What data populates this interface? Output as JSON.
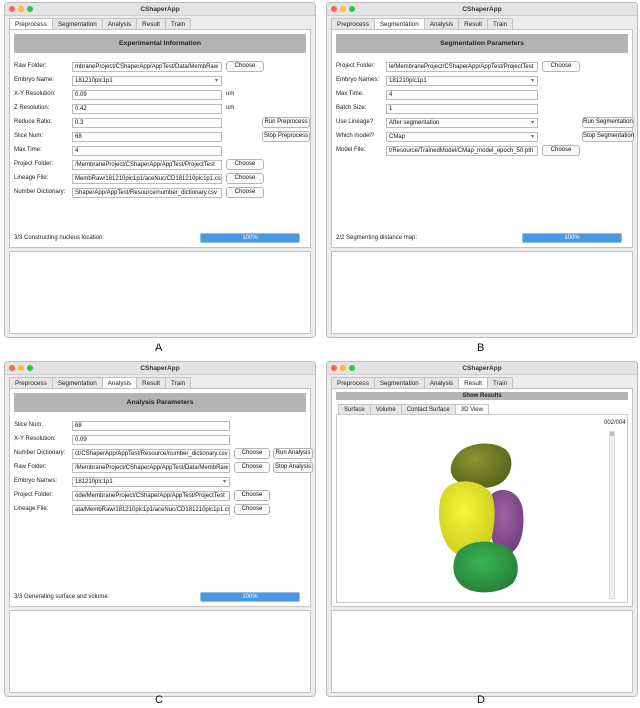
{
  "app_title": "CShaperApp",
  "tabs": [
    "Preprocess",
    "Segmentation",
    "Analysis",
    "Result",
    "Train"
  ],
  "colors": {
    "header_gray": "#b4b4b4",
    "progress_blue": "#4a99e0",
    "cell_olive": "#717d1f",
    "cell_yellow": "#e6e823",
    "cell_purple": "#8a4f93",
    "cell_green": "#2f9a45"
  },
  "preprocess": {
    "header": "Experimental Information",
    "fields": {
      "raw_folder": {
        "label": "Raw Folder:",
        "value": "mbraneProject/CShaperApp/AppTest/Data/MembRaw"
      },
      "embryo_name": {
        "label": "Embryo Name:",
        "value": "181210plc1p1"
      },
      "xy_resolution": {
        "label": "X-Y Resolution:",
        "value": "0.09",
        "unit": "um"
      },
      "z_resolution": {
        "label": "Z Resolution:",
        "value": "0.42",
        "unit": "um"
      },
      "reduce_ratio": {
        "label": "Reduce Ratio:",
        "value": "0.3"
      },
      "slice_num": {
        "label": "Slice Num:",
        "value": "68"
      },
      "max_time": {
        "label": "Max Time:",
        "value": "4"
      },
      "project_folder": {
        "label": "Project Folder:",
        "value": "/MembraneProject/CShaperApp/AppTest/ProjectTest"
      },
      "lineage_file": {
        "label": "Lineage File:",
        "value": "MembRaw/181210plc1p1/aceNuc/CD181210plc1p1.csv"
      },
      "number_dictionary": {
        "label": "Number Dictionary:",
        "value": "ShaperApp/AppTest/Resource/number_dictionary.csv"
      }
    },
    "buttons": {
      "choose": "Choose",
      "run": "Run Preprocess",
      "stop": "Stop Preprocess"
    },
    "status": "3/3 Constructing nucleus location:",
    "progress": {
      "percent": 100,
      "label": "100%"
    }
  },
  "segmentation": {
    "header": "Segmentation Parameters",
    "fields": {
      "project_folder": {
        "label": "Project Folder:",
        "value": "le/MembraneProject/CShaperApp/AppTest/ProjectTest"
      },
      "embryo_names": {
        "label": "Embryo Names:",
        "value": "181210plc1p1"
      },
      "max_time": {
        "label": "Max Time:",
        "value": "4"
      },
      "batch_size": {
        "label": "Batch Size:",
        "value": "1"
      },
      "use_lineage": {
        "label": "Use Lineage?",
        "value": "After segmentation"
      },
      "which_model": {
        "label": "Which model?",
        "value": "CMap"
      },
      "model_file": {
        "label": "Model File:",
        "value": "t/Resource/TrainedModel/CMap_model_epoch_50.pth"
      }
    },
    "buttons": {
      "choose": "Choose",
      "run": "Run Segmentation",
      "stop": "Stop Segmentation"
    },
    "status": "2/2 Segmenting distance map:",
    "progress": {
      "percent": 100,
      "label": "100%"
    }
  },
  "analysis": {
    "header": "Analysis Parameters",
    "fields": {
      "slice_num": {
        "label": "Slice Num:",
        "value": "68"
      },
      "xy_resolution": {
        "label": "X-Y Resolution:",
        "value": "0.09"
      },
      "number_dictionary": {
        "label": "Number Dictionary:",
        "value": "ct/CShaperApp/AppTest/Resource/number_dictionary.csv"
      },
      "raw_folder": {
        "label": "Raw Folder:",
        "value": "/MembraneProject/CShaperApp/AppTest/Data/MembRaw"
      },
      "embryo_names": {
        "label": "Embryo Names:",
        "value": "181210plc1p1"
      },
      "project_folder": {
        "label": "Project Folder:",
        "value": "ode/MembraneProject/CShaperApp/AppTest/ProjectTest"
      },
      "lineage_file": {
        "label": "Lineage File:",
        "value": "ata/MembRaw/181210plc1p1/aceNuc/CD181210plc1p1.csv"
      }
    },
    "buttons": {
      "choose": "Choose",
      "run": "Run Analysis",
      "stop": "Stop Analysis"
    },
    "status": "3/3 Generating surface and volume:",
    "progress": {
      "percent": 100,
      "label": "100%"
    }
  },
  "result": {
    "header": "Show Results",
    "subtabs": [
      "Surface",
      "Volume",
      "Contact Surface",
      "3D View"
    ],
    "frame_label": "002/004"
  },
  "captions": {
    "a": "A",
    "b": "B",
    "c": "C",
    "d": "D"
  }
}
